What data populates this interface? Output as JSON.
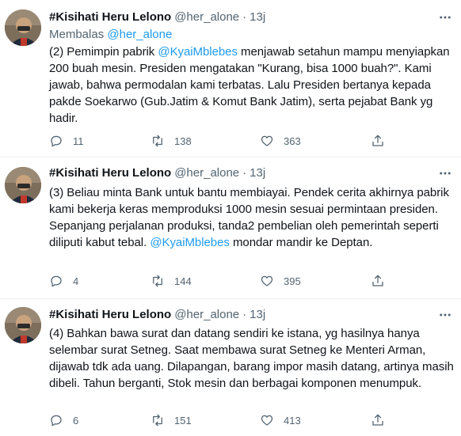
{
  "tweets": [
    {
      "display_name": "#Kisihati Heru Lelono",
      "handle": "@her_alone",
      "separator": "·",
      "time": "13j",
      "reply_prefix": "Membalas",
      "reply_handle": "@her_alone",
      "body": [
        {
          "text": "(2) Pemimpin pabrik ",
          "mention": false
        },
        {
          "text": "@KyaiMblebes",
          "mention": true
        },
        {
          "text": " menjawab setahun mampu menyiapkan 200 buah mesin. Presiden mengatakan \"Kurang, bisa 1000 buah?\". Kami jawab, bahwa permodalan kami terbatas. Lalu Presiden bertanya kepada pakde Soekarwo (Gub.Jatim & Komut Bank Jatim), serta pejabat Bank yg hadir.",
          "mention": false
        }
      ],
      "replies": "11",
      "retweets": "138",
      "likes": "363"
    },
    {
      "display_name": "#Kisihati Heru Lelono",
      "handle": "@her_alone",
      "separator": "·",
      "time": "13j",
      "body": [
        {
          "text": "(3) Beliau minta Bank untuk bantu membiayai. Pendek cerita akhirnya pabrik kami bekerja keras memproduksi 1000 mesin sesuai permintaan presiden. Sepanjang perjalanan produksi, tanda2 pembelian oleh pemerintah seperti diliputi kabut tebal. ",
          "mention": false
        },
        {
          "text": "@KyaiMblebes",
          "mention": true
        },
        {
          "text": " mondar mandir ke Deptan.",
          "mention": false
        }
      ],
      "replies": "4",
      "retweets": "144",
      "likes": "395"
    },
    {
      "display_name": "#Kisihati Heru Lelono",
      "handle": "@her_alone",
      "separator": "·",
      "time": "13j",
      "body": [
        {
          "text": "(4) Bahkan bawa surat dan datang sendiri ke istana, yg hasilnya hanya selembar surat Setneg. Saat membawa surat Setneg ke Menteri Arman, dijawab tdk ada uang.  Dilapangan, barang impor masih datang, artinya masih dibeli. Tahun berganti, Stok mesin dan berbagai komponen menumpuk.",
          "mention": false
        }
      ],
      "replies": "6",
      "retweets": "151",
      "likes": "413"
    }
  ],
  "colors": {
    "text": "#0f1419",
    "muted": "#536471",
    "link": "#1d9bf0",
    "divider": "#eff3f4"
  },
  "icons": [
    "reply-icon",
    "retweet-icon",
    "like-icon",
    "share-icon",
    "more-icon"
  ]
}
